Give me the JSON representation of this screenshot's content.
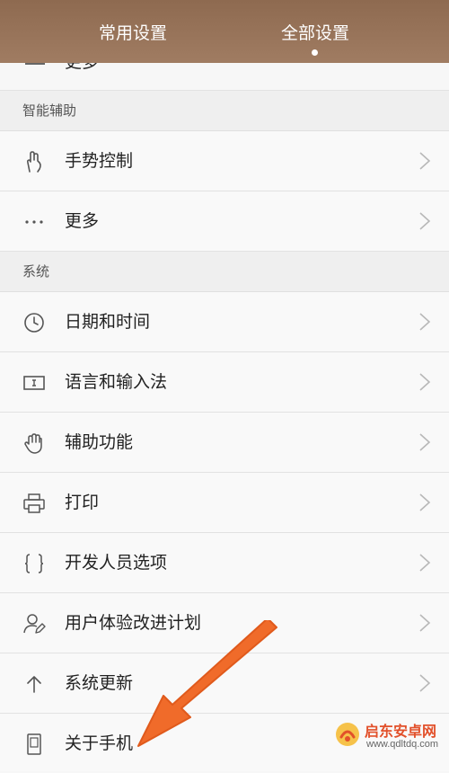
{
  "header": {
    "tabs": [
      {
        "label": "常用设置",
        "selected": false
      },
      {
        "label": "全部设置",
        "selected": true
      }
    ]
  },
  "partial_row": {
    "label": "更多"
  },
  "sections": [
    {
      "title": "智能辅助",
      "items": [
        {
          "label": "手势控制",
          "icon": "gesture-hand-icon"
        },
        {
          "label": "更多",
          "icon": "more-dots-icon"
        }
      ]
    },
    {
      "title": "系统",
      "items": [
        {
          "label": "日期和时间",
          "icon": "clock-icon"
        },
        {
          "label": "语言和输入法",
          "icon": "input-cursor-icon"
        },
        {
          "label": "辅助功能",
          "icon": "hand-icon"
        },
        {
          "label": "打印",
          "icon": "printer-icon"
        },
        {
          "label": "开发人员选项",
          "icon": "braces-icon"
        },
        {
          "label": "用户体验改进计划",
          "icon": "user-edit-icon"
        },
        {
          "label": "系统更新",
          "icon": "arrow-up-icon"
        },
        {
          "label": "关于手机",
          "icon": "phone-icon"
        }
      ]
    }
  ],
  "overlay": {
    "annotation_arrow_color": "#f06b2a",
    "watermark_cn": "启东安卓网",
    "watermark_url": "www.qdltdq.com"
  },
  "colors": {
    "header_bg": "#98735a",
    "row_bg": "#f9f9f9",
    "section_bg": "#efefef"
  }
}
